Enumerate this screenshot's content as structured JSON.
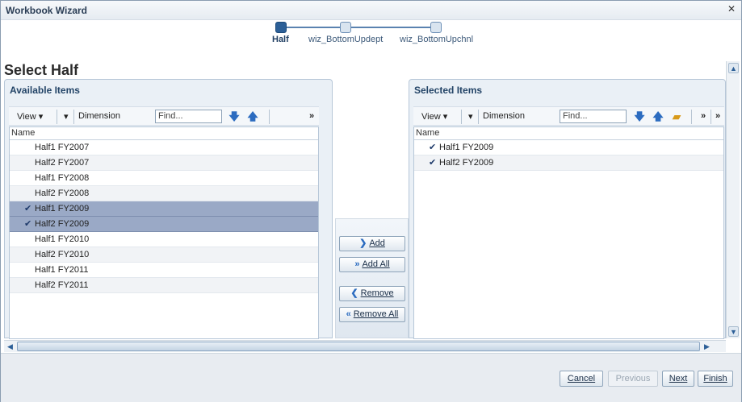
{
  "window": {
    "title": "Workbook Wizard",
    "close_glyph": "✕"
  },
  "train": {
    "stops": [
      {
        "label": "Half",
        "active": true
      },
      {
        "label": "wiz_BottomUpdept",
        "active": false
      },
      {
        "label": "wiz_BottomUpchnl",
        "active": false
      }
    ]
  },
  "page": {
    "title": "Select Half"
  },
  "available": {
    "title": "Available Items",
    "toolbar": {
      "view": "View",
      "dimension": "Dimension",
      "find_placeholder": "Find...",
      "overflow": "»"
    },
    "column": "Name",
    "rows": [
      {
        "label": "Half1 FY2007",
        "selected": false
      },
      {
        "label": "Half2 FY2007",
        "selected": false
      },
      {
        "label": "Half1 FY2008",
        "selected": false
      },
      {
        "label": "Half2 FY2008",
        "selected": false
      },
      {
        "label": "Half1 FY2009",
        "selected": true
      },
      {
        "label": "Half2 FY2009",
        "selected": true
      },
      {
        "label": "Half1 FY2010",
        "selected": false
      },
      {
        "label": "Half2 FY2010",
        "selected": false
      },
      {
        "label": "Half1 FY2011",
        "selected": false
      },
      {
        "label": "Half2 FY2011",
        "selected": false
      }
    ]
  },
  "selected": {
    "title": "Selected Items",
    "toolbar": {
      "view": "View",
      "dimension": "Dimension",
      "find_placeholder": "Find...",
      "overflow": "»"
    },
    "column": "Name",
    "rows": [
      {
        "label": "Half1 FY2009"
      },
      {
        "label": "Half2 FY2009"
      }
    ]
  },
  "actions": {
    "add": "Add",
    "add_all": "Add All",
    "remove": "Remove",
    "remove_all": "Remove All"
  },
  "footer": {
    "cancel": "Cancel",
    "previous": "Previous",
    "next": "Next",
    "finish": "Finish"
  },
  "icons": {
    "move_down": "arrow-down-icon",
    "move_up": "arrow-up-icon",
    "folder": "folder-icon",
    "check": "checkmark-icon"
  },
  "colors": {
    "accent": "#2c5f97",
    "selected_row": "#9aa9c6",
    "panel_bg": "#eaf0f6"
  }
}
